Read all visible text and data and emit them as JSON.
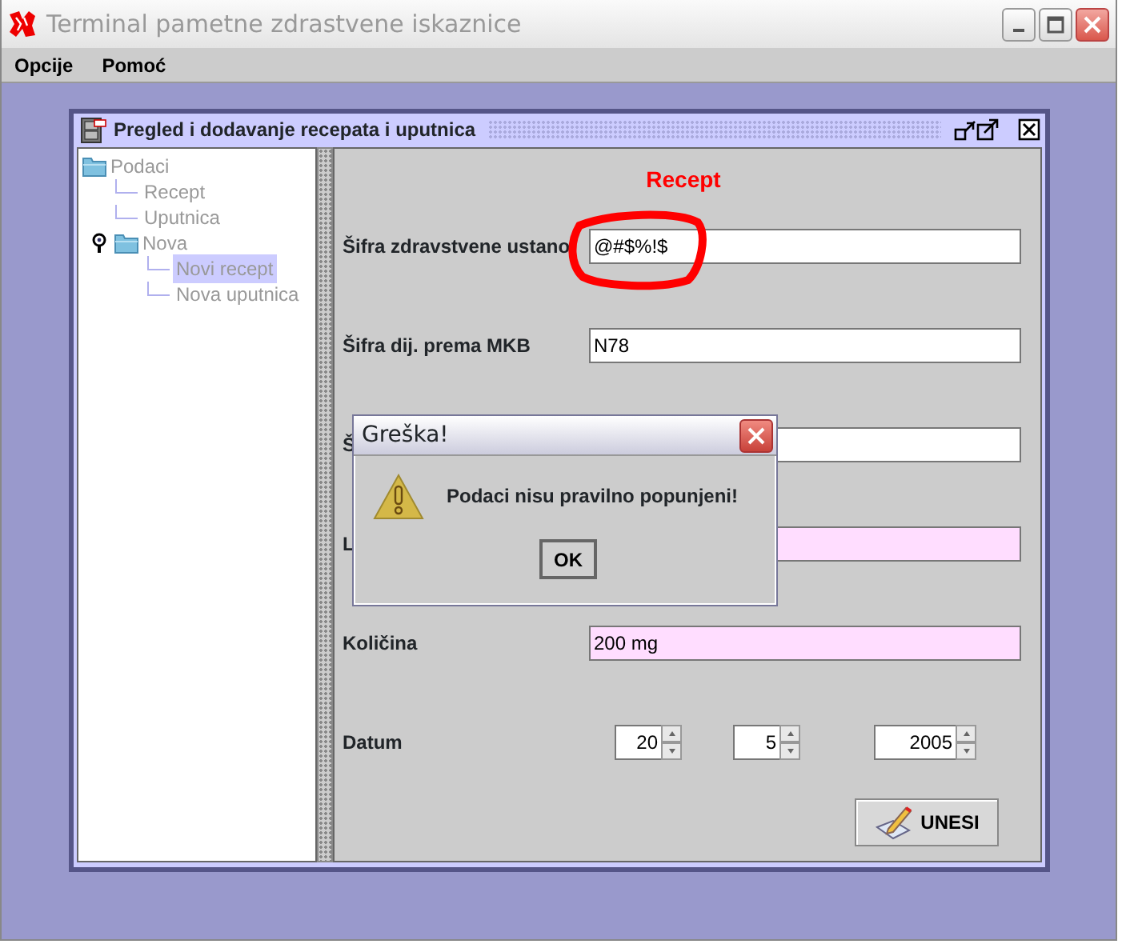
{
  "window": {
    "title": "Terminal pametne zdrastvene iskaznice"
  },
  "menu": [
    {
      "label": "Opcije"
    },
    {
      "label": "Pomoć"
    }
  ],
  "internal_frame": {
    "title": "Pregled i dodavanje recepata i uputnica",
    "tree": [
      {
        "label": "Podaci",
        "kind": "folder",
        "selected": false,
        "children": [
          {
            "label": "Recept",
            "kind": "leaf",
            "selected": false
          },
          {
            "label": "Uputnica",
            "kind": "leaf",
            "selected": false
          },
          {
            "label": "Nova",
            "kind": "folder",
            "selected": false,
            "expanded": true,
            "children": [
              {
                "label": "Novi recept",
                "kind": "leaf",
                "selected": true
              },
              {
                "label": "Nova uputnica",
                "kind": "leaf",
                "selected": false
              }
            ]
          }
        ]
      }
    ],
    "form": {
      "heading": "Recept",
      "rows": [
        {
          "kind": "text",
          "label": "Šifra zdravstvene ustano",
          "value": "@#$%!$",
          "highlighted": false
        },
        {
          "kind": "text",
          "label": "Šifra dij. prema MKB",
          "value": "N78",
          "highlighted": false
        },
        {
          "kind": "text",
          "label": "Š",
          "highlighted": false
        },
        {
          "kind": "text",
          "label": "L",
          "highlighted": true
        },
        {
          "kind": "text",
          "label": "Količina",
          "value": "200 mg",
          "highlighted": true
        },
        {
          "kind": "date",
          "label": "Datum",
          "values": [
            "20",
            "5",
            "2005"
          ]
        }
      ],
      "submit": "UNESI"
    }
  },
  "dialog": {
    "title": "Greška!",
    "message": "Podaci nisu pravilno popunjeni!",
    "button": "OK"
  }
}
